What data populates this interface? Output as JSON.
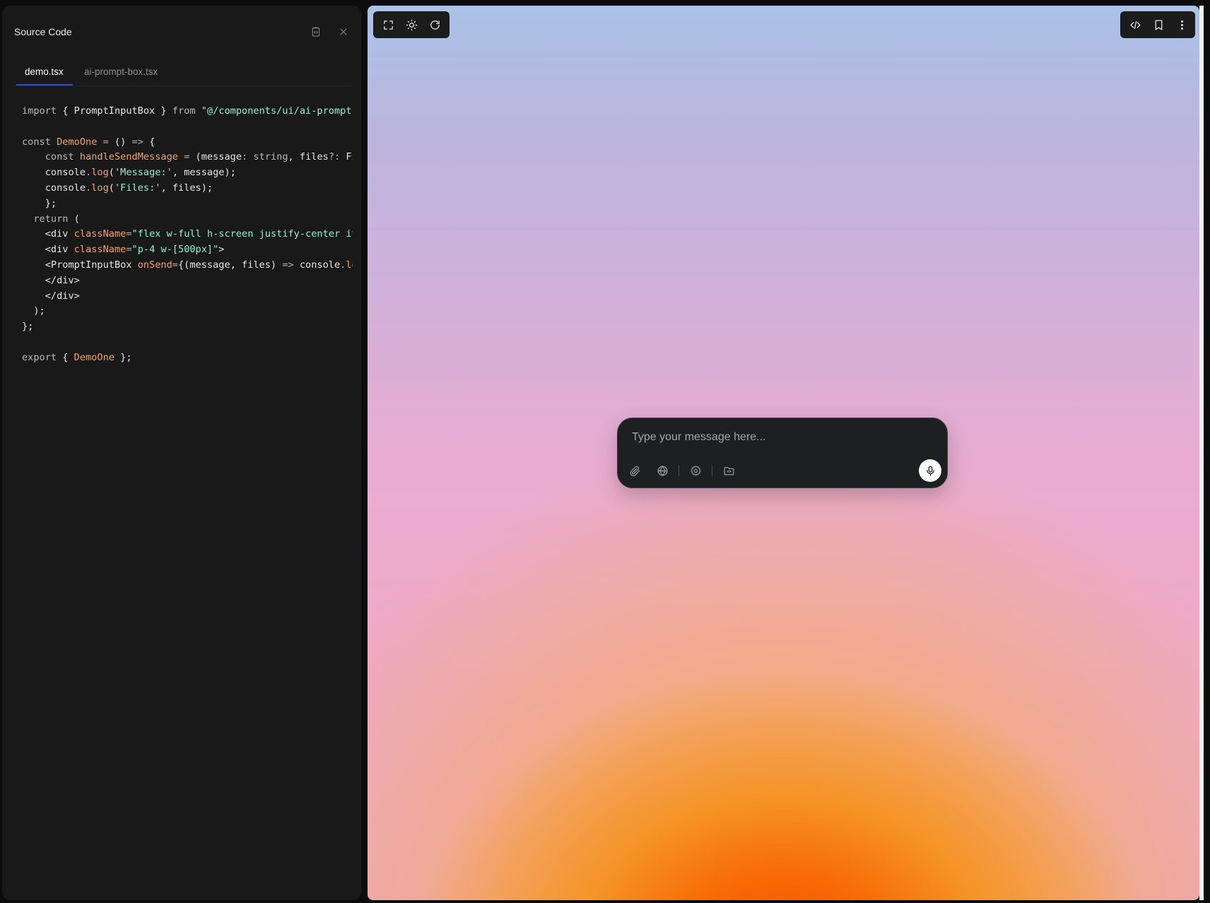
{
  "panel": {
    "title": "Source Code",
    "icons": {
      "copy": "clipboard-code-icon",
      "close": "close-icon"
    }
  },
  "tabs": [
    {
      "label": "demo.tsx",
      "active": true
    },
    {
      "label": "ai-prompt-box.tsx",
      "active": false
    }
  ],
  "code": {
    "lines": [
      "import { PromptInputBox } from \"@/components/ui/ai-prompt-box\";",
      "",
      "const DemoOne = () => {",
      "    const handleSendMessage = (message: string, files?: File[]) => {",
      "    console.log('Message:', message);",
      "    console.log('Files:', files);",
      "    };",
      "  return (",
      "    <div className=\"flex w-full h-screen justify-center items-center\">",
      "    <div className=\"p-4 w-[500px]\">",
      "    <PromptInputBox onSend={(message, files) => console.log(message, files)} />",
      "    </div>",
      "    </div>",
      "  );",
      "};",
      "",
      "export { DemoOne };"
    ]
  },
  "preview_toolbar": {
    "left_icons": [
      "fullscreen-icon",
      "sun-icon",
      "refresh-icon"
    ],
    "right_icons": [
      "code-icon",
      "bookmark-icon",
      "more-vertical-icon"
    ]
  },
  "prompt_box": {
    "placeholder": "Type your message here...",
    "tools": [
      "paperclip-icon",
      "globe-icon",
      "settings-icon",
      "folder-code-icon"
    ],
    "send": "mic-icon"
  },
  "colors": {
    "panel_bg": "#191919",
    "tab_accent": "#2f4fd6",
    "string": "#8ff0cf",
    "identifier": "#f5a36a",
    "gradient_core": "#f95300"
  }
}
